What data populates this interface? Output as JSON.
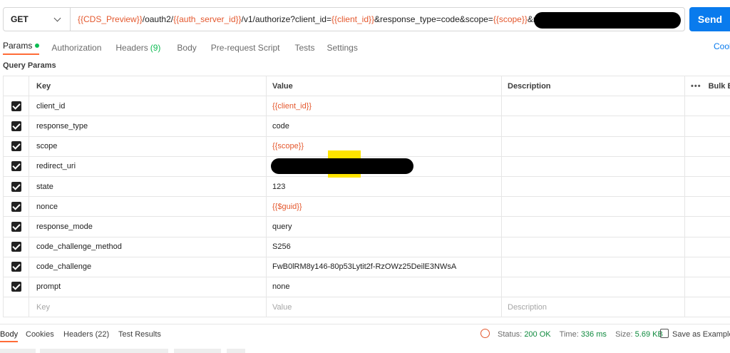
{
  "request": {
    "method": "GET",
    "url_parts": [
      {
        "text": "{{CDS_Preview}}",
        "var": true
      },
      {
        "text": "/oauth2/",
        "var": false
      },
      {
        "text": "{{auth_server_id}}",
        "var": true
      },
      {
        "text": "/v1/authorize?client_id=",
        "var": false
      },
      {
        "text": "{{client_id}}",
        "var": true
      },
      {
        "text": "&response_type=code&scope=",
        "var": false
      },
      {
        "text": "{{scope}}",
        "var": true
      },
      {
        "text": "&redirect_uri",
        "var": false
      }
    ],
    "send_label": "Send"
  },
  "tabs": {
    "params": "Params",
    "authorization": "Authorization",
    "headers": "Headers",
    "headers_count": "(9)",
    "body": "Body",
    "prerequest": "Pre-request Script",
    "tests": "Tests",
    "settings": "Settings",
    "cookies": "Cool"
  },
  "section_label": "Query Params",
  "table": {
    "headers": {
      "key": "Key",
      "value": "Value",
      "description": "Description",
      "bulk": "Bulk Ed"
    },
    "rows": [
      {
        "key": "client_id",
        "value": "{{client_id}}",
        "var": true
      },
      {
        "key": "response_type",
        "value": "code",
        "var": false
      },
      {
        "key": "scope",
        "value": "{{scope}}",
        "var": true
      },
      {
        "key": "redirect_uri",
        "value": "",
        "var": false
      },
      {
        "key": "state",
        "value": "123",
        "var": false
      },
      {
        "key": "nonce",
        "value": "{{$guid}}",
        "var": true
      },
      {
        "key": "response_mode",
        "value": "query",
        "var": false
      },
      {
        "key": "code_challenge_method",
        "value": "S256",
        "var": false
      },
      {
        "key": "code_challenge",
        "value": "FwB0lRM8y146-80p53Lytit2f-RzOWz25DeilE3NWsA",
        "var": false
      },
      {
        "key": "prompt",
        "value": "none",
        "var": false
      }
    ],
    "placeholder": {
      "key": "Key",
      "value": "Value",
      "description": "Description"
    }
  },
  "response": {
    "tabs": [
      "Body",
      "Cookies",
      "Headers (22)",
      "Test Results"
    ],
    "status_label": "Status:",
    "status_value": "200 OK",
    "time_label": "Time:",
    "time_value": "336 ms",
    "size_label": "Size:",
    "size_value": "5.69 KB",
    "save_label": "Save as Example"
  },
  "colors": {
    "accent": "#ff6c37",
    "send": "#097bed",
    "variable": "#e4582e",
    "ok": "#0f8a3e"
  }
}
